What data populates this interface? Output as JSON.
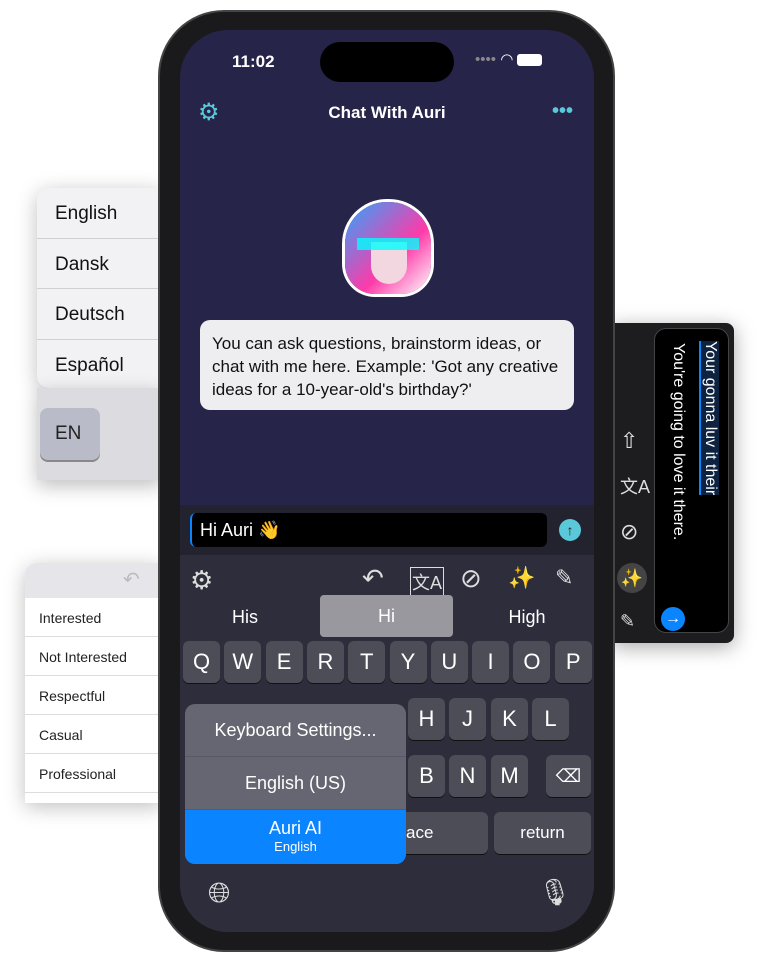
{
  "languages": [
    "English",
    "Dansk",
    "Deutsch",
    "Español"
  ],
  "language_key": "EN",
  "tones": [
    "Interested",
    "Not Interested",
    "Respectful",
    "Casual",
    "Professional"
  ],
  "status": {
    "time": "11:02"
  },
  "header": {
    "title": "Chat With Auri"
  },
  "chat": {
    "message": "You can ask questions, brainstorm ideas, or chat with me here. Example: 'Got any creative ideas for a 10-year-old's birthday?'"
  },
  "input": {
    "value": "Hi Auri 👋"
  },
  "suggestions": [
    "His",
    "Hi",
    "High"
  ],
  "keys": {
    "row1": [
      "Q",
      "W",
      "E",
      "R",
      "T",
      "Y",
      "U",
      "I",
      "O",
      "P"
    ],
    "row2": [
      "H",
      "J",
      "K",
      "L"
    ],
    "row3": [
      "B",
      "N",
      "M"
    ],
    "space": "ace",
    "return": "return"
  },
  "menu": {
    "settings": "Keyboard Settings...",
    "english": "English (US)",
    "auri": "Auri AI",
    "auri_sub": "English"
  },
  "correction": {
    "original": "Your gonna luv it their",
    "corrected": "You're going to love it there."
  },
  "colors": {
    "accent": "#0a84ff",
    "chat_bg": "#27244a",
    "teal": "#5ac8d8"
  }
}
